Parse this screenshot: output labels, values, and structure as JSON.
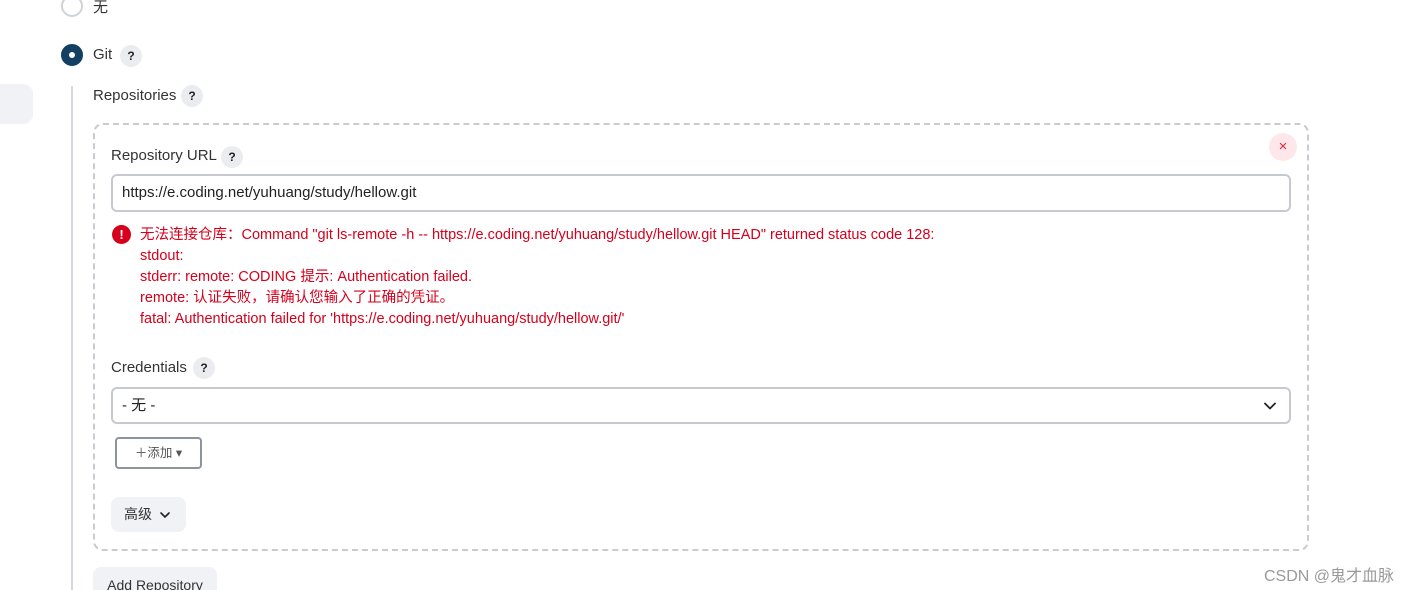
{
  "scm_options": {
    "none_label": "无",
    "git_label": "Git"
  },
  "help_icon_text": "?",
  "repositories": {
    "label": "Repositories",
    "remove_label": "×",
    "url_label": "Repository URL",
    "url_value": "https://e.coding.net/yuhuang/study/hellow.git",
    "error_icon": "!",
    "error_lines": [
      "无法连接仓库：Command \"git ls-remote -h -- https://e.coding.net/yuhuang/study/hellow.git HEAD\" returned status code 128:",
      "stdout:",
      "stderr: remote: CODING 提示: Authentication failed.",
      "remote: 认证失败，请确认您输入了正确的凭证。",
      "fatal: Authentication failed for 'https://e.coding.net/yuhuang/study/hellow.git/'"
    ],
    "credentials_label": "Credentials",
    "credentials_selected": "- 无 -",
    "add_button_label": "＋添加 ▾",
    "advanced_label": "高级",
    "add_repository_label": "Add Repository"
  },
  "watermark": "CSDN @鬼才血脉",
  "colors": {
    "accent": "#133f63",
    "error": "#d6001c"
  }
}
